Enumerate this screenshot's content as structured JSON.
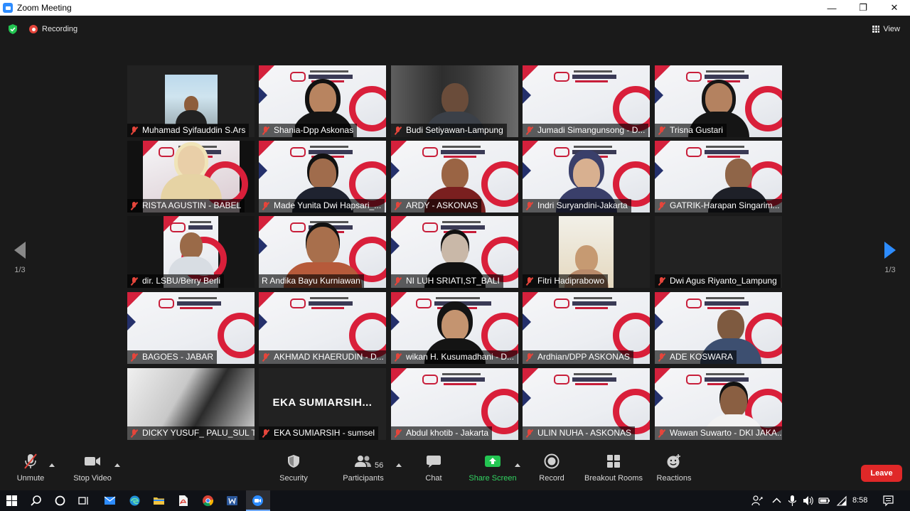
{
  "window": {
    "title": "Zoom Meeting",
    "minimize": "—",
    "maximize": "❐",
    "close": "✕"
  },
  "status": {
    "recording_label": "Recording",
    "view_label": "View"
  },
  "pagination": {
    "left": "1/3",
    "right": "1/3"
  },
  "participants": [
    {
      "name": "Muhamad Syifauddin S.Ars"
    },
    {
      "name": "Shania-Dpp Askonas"
    },
    {
      "name": "Budi Setiyawan-Lampung"
    },
    {
      "name": "Jumadi Simangunsong - D..."
    },
    {
      "name": "Trisna Gustari"
    },
    {
      "name": "RISTA AGUSTIN - BABEL"
    },
    {
      "name": "Made Yunita Dwi Hapsari_..."
    },
    {
      "name": "ARDY - ASKONAS"
    },
    {
      "name": "Indri Suryandini-Jakarta"
    },
    {
      "name": "GATRIK-Harapan Singarim..."
    },
    {
      "name": "dir. LSBU/Berry Berli"
    },
    {
      "name": "R Andika Bayu Kurniawan"
    },
    {
      "name": "NI LUH SRIATI,ST_BALI"
    },
    {
      "name": "Fitri Hadiprabowo"
    },
    {
      "name": "Dwi Agus Riyanto_Lampung"
    },
    {
      "name": "BAGOES - JABAR"
    },
    {
      "name": "AKHMAD KHAERUDIN - D..."
    },
    {
      "name": "wikan H. Kusumadhani - D..."
    },
    {
      "name": "Ardhian/DPP ASKONAS"
    },
    {
      "name": "ADE KOSWARA"
    },
    {
      "name": "DICKY YUSUF_ PALU_SUL T..."
    },
    {
      "name": "EKA SUMIARSIH - sumsel",
      "display_name": "EKA  SUMIARSIH..."
    },
    {
      "name": "Abdul khotib - Jakarta"
    },
    {
      "name": "ULIN NUHA - ASKONAS"
    },
    {
      "name": "Wawan Suwarto - DKI JAKA..."
    }
  ],
  "toolbar": {
    "unmute": "Unmute",
    "stop_video": "Stop Video",
    "security": "Security",
    "participants": "Participants",
    "participant_count": "56",
    "chat": "Chat",
    "share_screen": "Share Screen",
    "record": "Record",
    "breakout_rooms": "Breakout Rooms",
    "reactions": "Reactions",
    "leave": "Leave"
  },
  "taskbar": {
    "time": "8:58"
  },
  "colors": {
    "accent": "#2d8cff",
    "danger": "#e02828",
    "active_speaker": "#c6e03b",
    "share_green": "#32d462"
  }
}
